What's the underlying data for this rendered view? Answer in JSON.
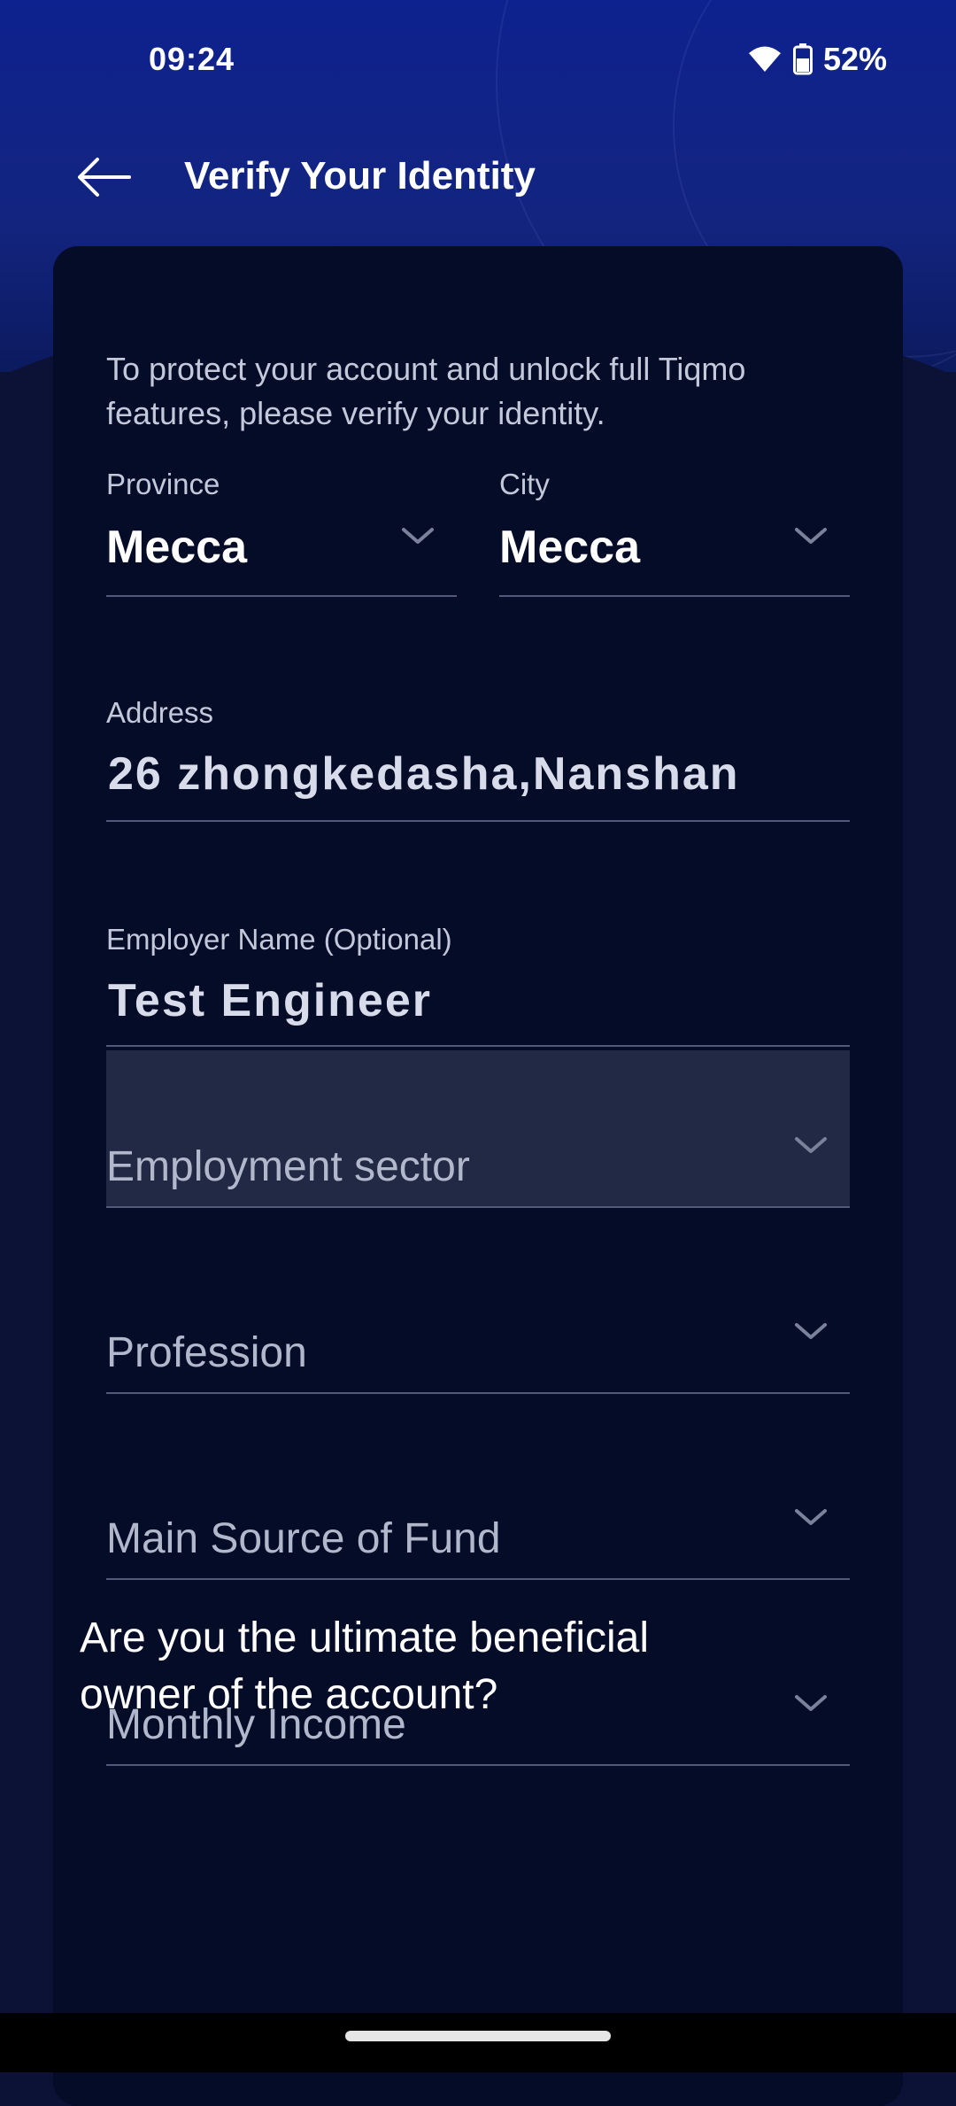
{
  "status_bar": {
    "time": "09:24",
    "battery": "52%"
  },
  "header": {
    "title": "Verify Your Identity"
  },
  "intro_text": "To protect your account and unlock full Tiqmo features, please verify your identity.",
  "form": {
    "province": {
      "label": "Province",
      "value": "Mecca"
    },
    "city": {
      "label": "City",
      "value": "Mecca"
    },
    "address": {
      "label": "Address",
      "value": "26 zhongkedasha,Nanshan"
    },
    "employer": {
      "label": "Employer Name (Optional)",
      "value": "Test Engineer"
    },
    "employment_sector": {
      "placeholder": "Employment sector"
    },
    "profession": {
      "placeholder": "Profession"
    },
    "source_of_fund": {
      "placeholder": "Main Source of Fund"
    },
    "monthly_income": {
      "placeholder": "Monthly Income"
    }
  },
  "question": "Are you the ultimate beneficial owner of the account?",
  "colors": {
    "header_blue": "#0e228f",
    "card_bg": "#050c28",
    "highlight_bg": "#222944"
  }
}
